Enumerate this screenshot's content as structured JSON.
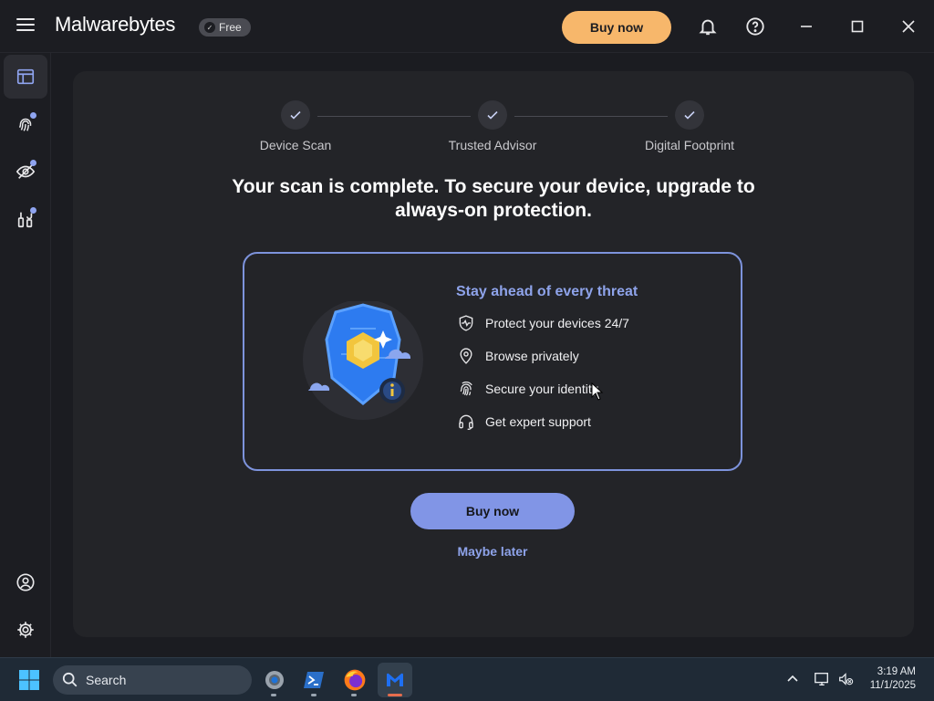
{
  "app": {
    "logo_text": "Malwarebytes",
    "plan_badge": "Free",
    "buy_now_label": "Buy now"
  },
  "sidebar": {
    "items": [
      {
        "icon": "dashboard-icon",
        "active": true
      },
      {
        "icon": "fingerprint-icon",
        "notification_dot": true
      },
      {
        "icon": "privacy-eye-icon",
        "notification_dot": true
      },
      {
        "icon": "tools-icon",
        "notification_dot": true
      },
      {
        "icon": "account-icon"
      },
      {
        "icon": "settings-gear-icon"
      }
    ]
  },
  "steps": [
    {
      "label": "Device Scan",
      "done": true
    },
    {
      "label": "Trusted Advisor",
      "done": true
    },
    {
      "label": "Digital Footprint",
      "done": true
    }
  ],
  "headline": {
    "line1": "Your scan is complete. To secure your device, upgrade to",
    "line2": "always-on protection."
  },
  "promo": {
    "title": "Stay ahead of every threat",
    "features": [
      {
        "icon": "shield-pulse-icon",
        "label": "Protect your devices 24/7"
      },
      {
        "icon": "location-pin-icon",
        "label": "Browse privately"
      },
      {
        "icon": "fingerprint-icon",
        "label": "Secure your identity"
      },
      {
        "icon": "headset-icon",
        "label": "Get expert support"
      }
    ]
  },
  "actions": {
    "buy_now": "Buy now",
    "maybe_later": "Maybe later"
  },
  "taskbar": {
    "search_placeholder": "Search",
    "apps": [
      "settings-app-icon",
      "powershell-icon",
      "firefox-icon",
      "malwarebytes-icon"
    ],
    "time": "3:19 AM",
    "date": "11/1/2025"
  },
  "colors": {
    "accent_orange": "#f7b76b",
    "accent_blue": "#8195e6",
    "link_blue": "#8ea3ea"
  }
}
